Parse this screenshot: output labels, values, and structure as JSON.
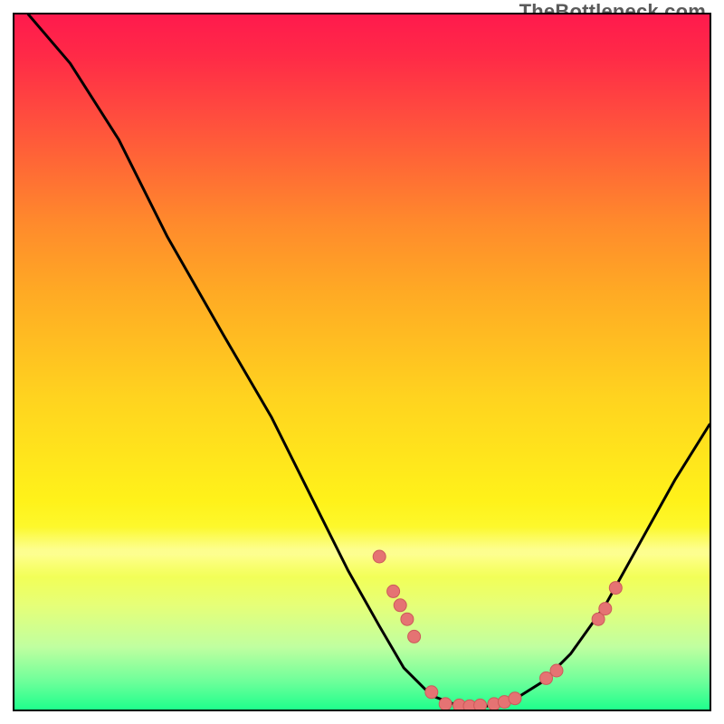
{
  "watermark": "TheBottleneck.com",
  "chart_data": {
    "type": "line",
    "title": "",
    "xlabel": "",
    "ylabel": "",
    "xlim": [
      0,
      100
    ],
    "ylim": [
      0,
      100
    ],
    "grid": false,
    "legend": false,
    "curve": {
      "comment": "x,y pairs (0-100 range) of the black performance/bottleneck curve; y=100 is top (worst), y=0 is bottom (best)",
      "points": [
        [
          2,
          100
        ],
        [
          8,
          93
        ],
        [
          15,
          82
        ],
        [
          22,
          68
        ],
        [
          30,
          54
        ],
        [
          37,
          42
        ],
        [
          43,
          30
        ],
        [
          48,
          20
        ],
        [
          52.5,
          12
        ],
        [
          56,
          6
        ],
        [
          60,
          2
        ],
        [
          64,
          0.5
        ],
        [
          68,
          0.5
        ],
        [
          72,
          1.5
        ],
        [
          76,
          4
        ],
        [
          80,
          8
        ],
        [
          85,
          15
        ],
        [
          90,
          24
        ],
        [
          95,
          33
        ],
        [
          100,
          41
        ]
      ]
    },
    "highlight_dots": {
      "comment": "salmon/pink data markers visible on the curve",
      "points": [
        [
          52.5,
          22
        ],
        [
          54.5,
          17
        ],
        [
          55.5,
          15
        ],
        [
          56.5,
          13
        ],
        [
          57.5,
          10.5
        ],
        [
          60,
          2.5
        ],
        [
          62,
          0.8
        ],
        [
          64,
          0.6
        ],
        [
          65.5,
          0.5
        ],
        [
          67,
          0.6
        ],
        [
          69,
          0.8
        ],
        [
          70.5,
          1.1
        ],
        [
          72,
          1.6
        ],
        [
          76.5,
          4.5
        ],
        [
          78,
          5.6
        ],
        [
          84,
          13
        ],
        [
          85,
          14.5
        ],
        [
          86.5,
          17.5
        ]
      ]
    },
    "gradient_bands": [
      {
        "y": 100,
        "color": "#ff1a4d"
      },
      {
        "y": 50,
        "color": "#ffd31f"
      },
      {
        "y": 25,
        "color": "#fff21a"
      },
      {
        "y": 5,
        "color": "#6dff9a"
      },
      {
        "y": 0,
        "color": "#1fff8c"
      }
    ]
  }
}
